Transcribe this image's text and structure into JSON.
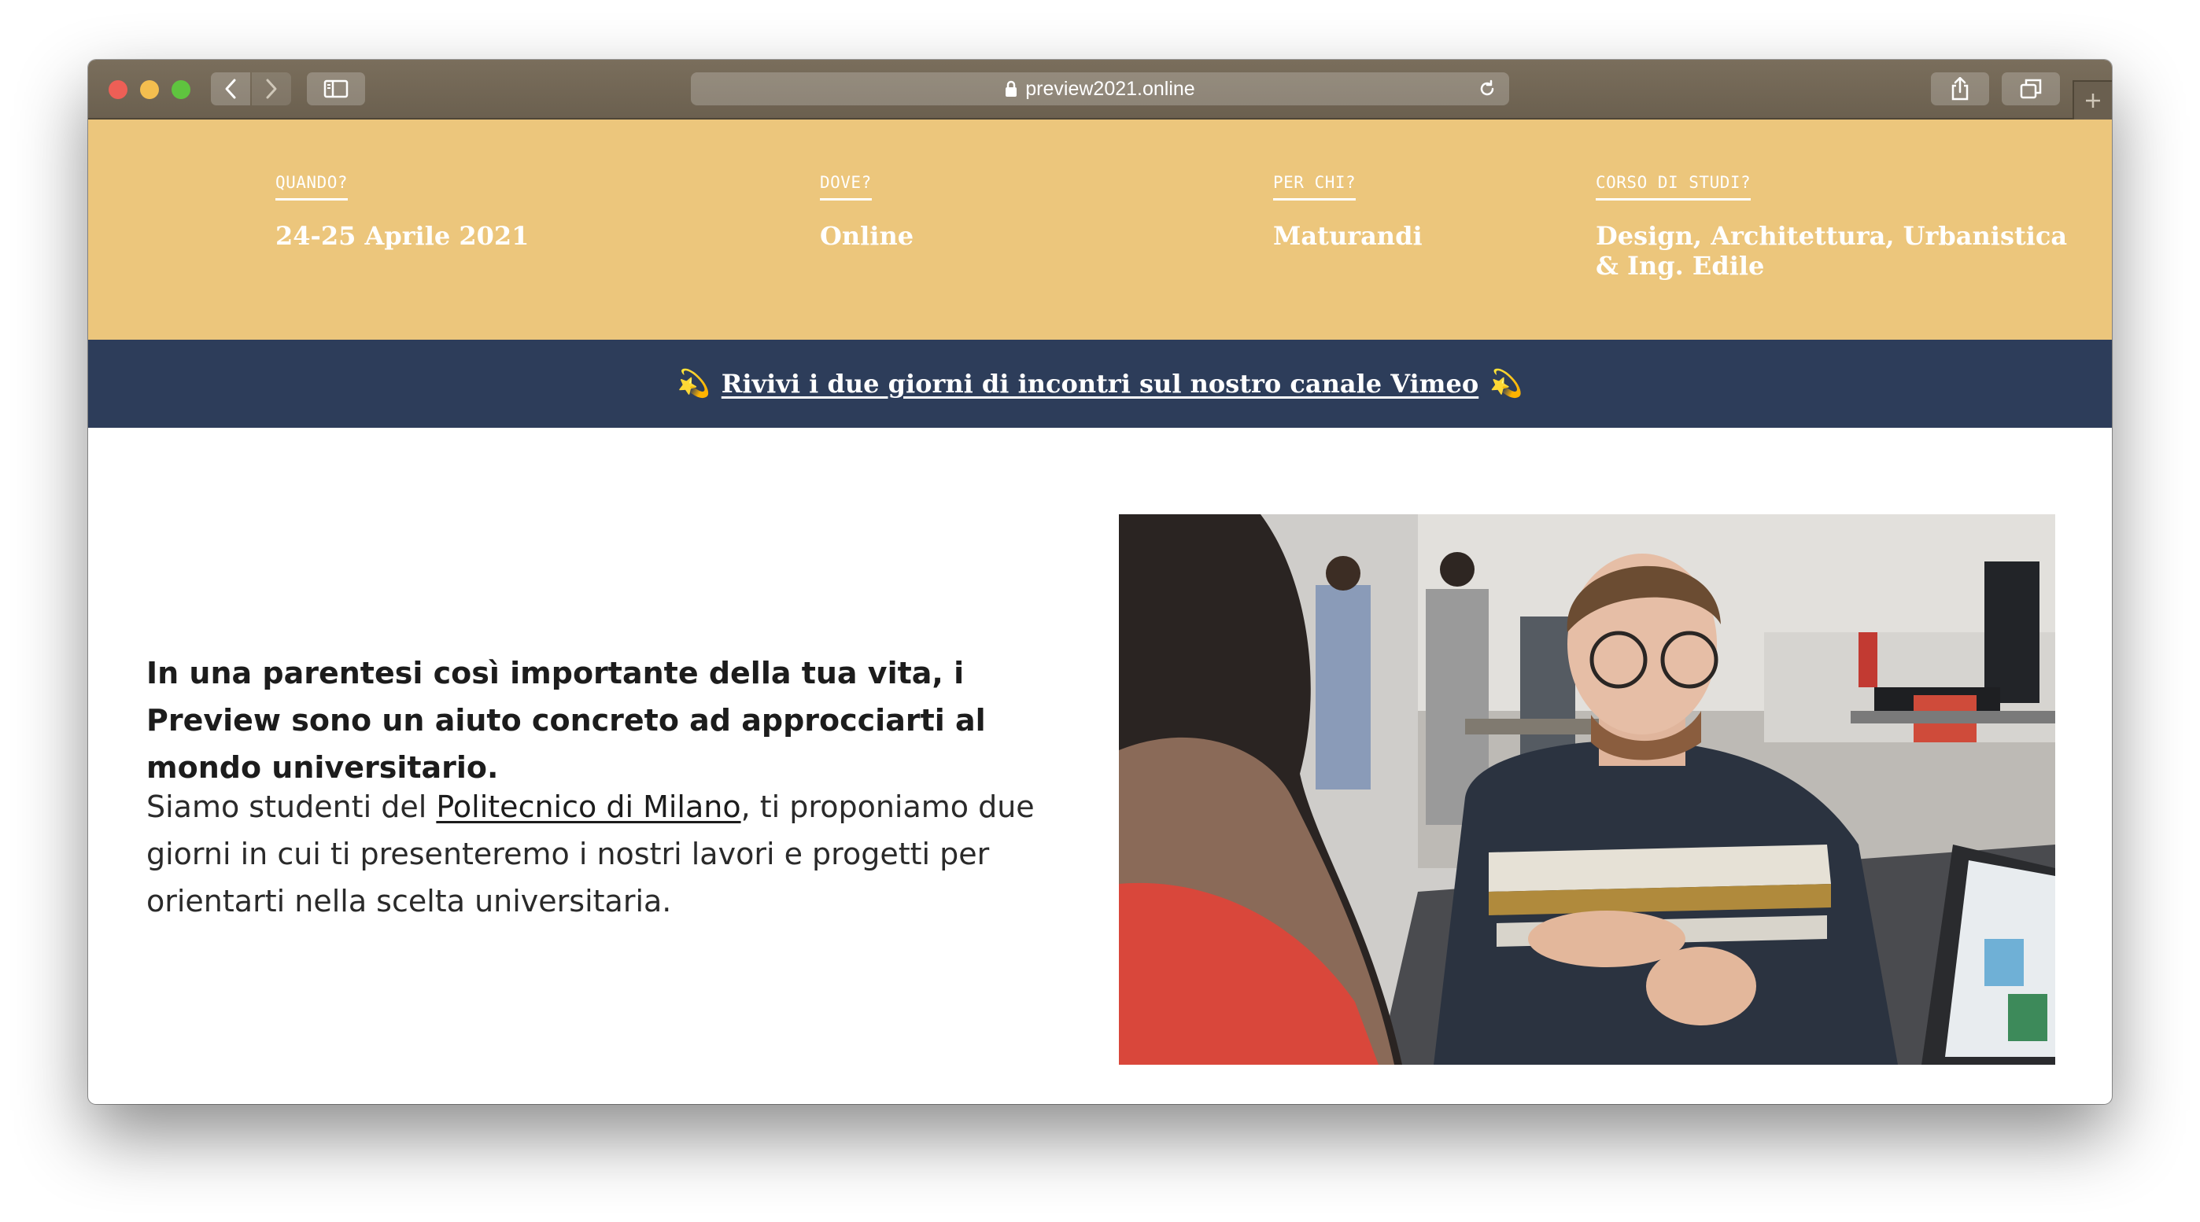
{
  "browser": {
    "url": "preview2021.online",
    "lock_icon": "lock-icon",
    "reload_icon": "reload-icon"
  },
  "info": {
    "items": [
      {
        "label": "QUANDO?",
        "value": "24-25 Aprile 2021"
      },
      {
        "label": "DOVE?",
        "value": "Online"
      },
      {
        "label": "PER CHI?",
        "value": "Maturandi"
      },
      {
        "label": "CORSO DI STUDI?",
        "value": "Design, Architettura, Urbanistica & Ing. Edile"
      }
    ]
  },
  "banner": {
    "emoji_left": "💫",
    "link_text": "Rivivi i due giorni di incontri sul nostro canale Vimeo",
    "emoji_right": "💫"
  },
  "content": {
    "lead": "In una parentesi così importante della tua vita, i Preview sono un aiuto concreto ad approcciarti al mondo universitario.",
    "body_prefix": "Siamo studenti del ",
    "body_link": "Politecnico di Milano",
    "body_suffix": ", ti proponiamo due giorni in cui ti presenteremo i nostri lavori e progetti per orientarti nella scelta universitaria."
  },
  "colors": {
    "info_bg": "#ecc67c",
    "banner_bg": "#2d3d5a"
  }
}
